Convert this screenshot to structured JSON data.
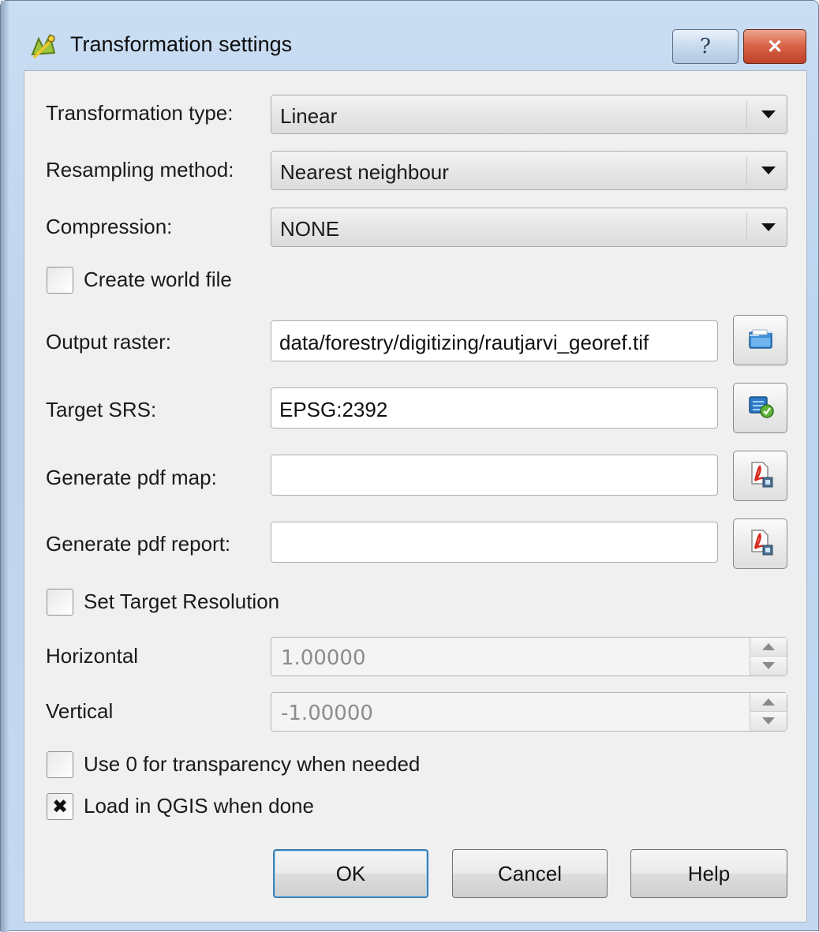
{
  "window": {
    "title": "Transformation settings",
    "help_button": "?",
    "close_button": "✕"
  },
  "fields": {
    "transformation_type": {
      "label": "Transformation type:",
      "value": "Linear"
    },
    "resampling_method": {
      "label": "Resampling method:",
      "value": "Nearest neighbour"
    },
    "compression": {
      "label": "Compression:",
      "value": "NONE"
    },
    "create_world_file": {
      "label": "Create world file",
      "checked": false
    },
    "output_raster": {
      "label": "Output raster:",
      "value": "data/forestry/digitizing/rautjarvi_georef.tif"
    },
    "target_srs": {
      "label": "Target SRS:",
      "value": "EPSG:2392"
    },
    "pdf_map": {
      "label": "Generate pdf map:",
      "value": ""
    },
    "pdf_report": {
      "label": "Generate pdf report:",
      "value": ""
    },
    "set_target_resolution": {
      "label": "Set Target Resolution",
      "checked": false
    },
    "horizontal": {
      "label": "Horizontal",
      "value": "1.00000"
    },
    "vertical": {
      "label": "Vertical",
      "value": "-1.00000"
    },
    "use_zero_transparency": {
      "label": "Use 0 for transparency when needed",
      "checked": false
    },
    "load_in_qgis": {
      "label": "Load in QGIS when done",
      "checked": true,
      "mark": "✖"
    }
  },
  "buttons": {
    "ok": "OK",
    "cancel": "Cancel",
    "help": "Help"
  },
  "icons": {
    "app": "qgis-logo-icon",
    "browse": "folder-open-icon",
    "srs": "globe-projection-icon",
    "pdf": "pdf-export-icon"
  }
}
